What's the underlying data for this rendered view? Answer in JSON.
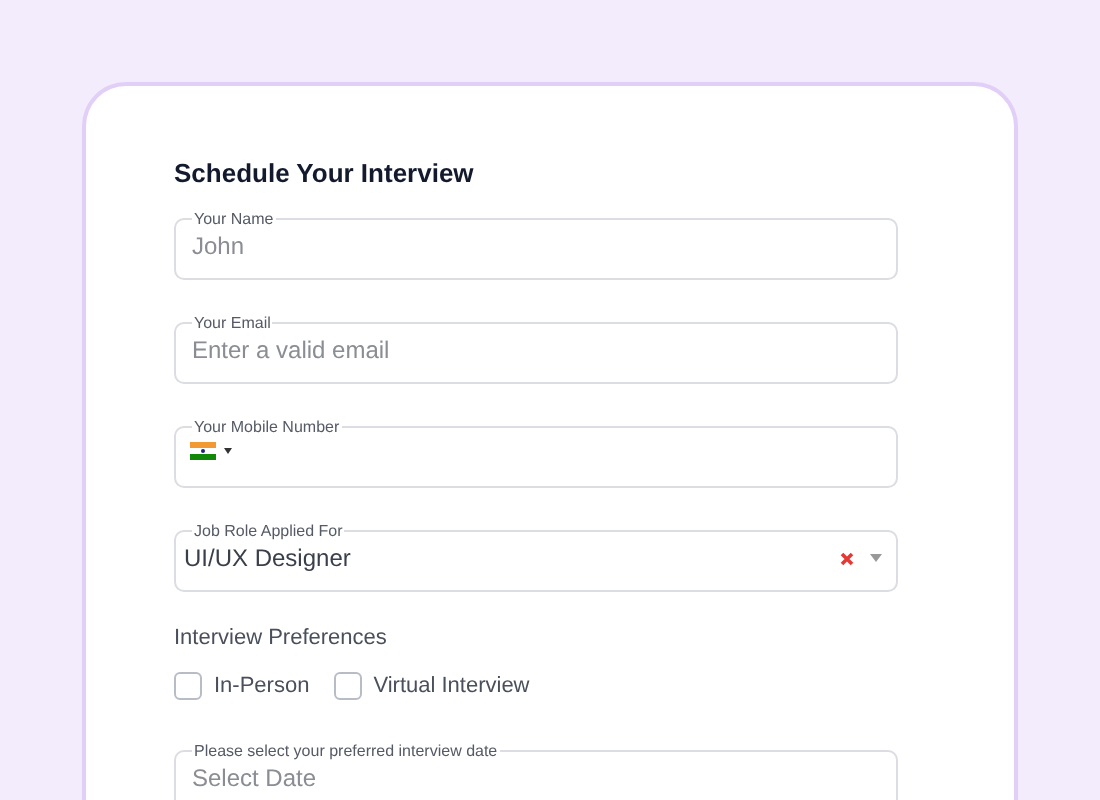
{
  "form": {
    "title": "Schedule Your Interview",
    "fields": [
      {
        "kind": "text",
        "label": "Your Name",
        "placeholder": "John"
      },
      {
        "kind": "text",
        "label": "Your Email",
        "placeholder": "Enter a valid email"
      },
      {
        "kind": "phone",
        "label": "Your Mobile Number"
      },
      {
        "kind": "select",
        "label": "Job Role Applied For",
        "value": "UI/UX Designer"
      }
    ],
    "preferences": {
      "label": "Interview Preferences",
      "options": [
        {
          "label": "In-Person",
          "checked": false
        },
        {
          "label": "Virtual Interview",
          "checked": false
        }
      ]
    },
    "date_field": {
      "label": "Please select your preferred interview date",
      "placeholder": "Select Date"
    }
  }
}
